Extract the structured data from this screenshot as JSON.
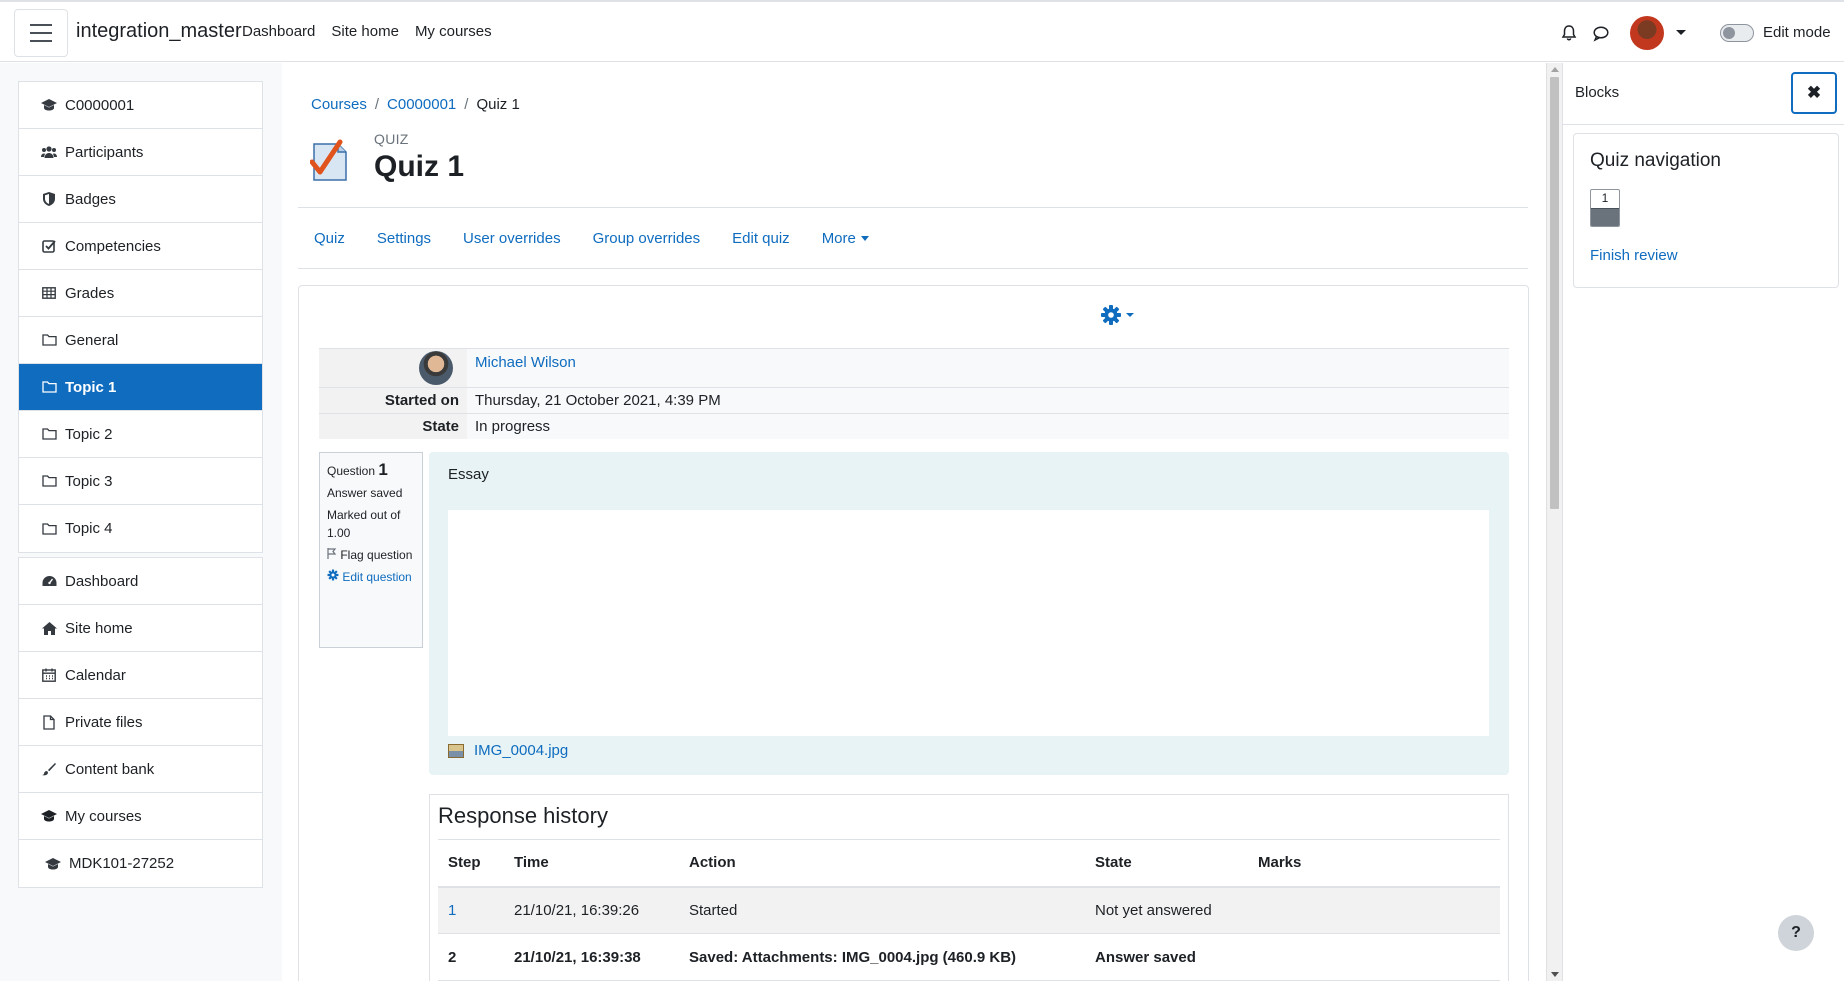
{
  "navbar": {
    "site_name": "integration_master",
    "links": [
      "Dashboard",
      "Site home",
      "My courses"
    ],
    "edit_mode_label": "Edit mode"
  },
  "left_nav": {
    "course_items": [
      {
        "label": "C0000001",
        "icon": "graduation-cap-icon"
      },
      {
        "label": "Participants",
        "icon": "users-icon"
      },
      {
        "label": "Badges",
        "icon": "shield-icon"
      },
      {
        "label": "Competencies",
        "icon": "check-square-icon"
      },
      {
        "label": "Grades",
        "icon": "table-icon"
      },
      {
        "label": "General",
        "icon": "folder-icon"
      },
      {
        "label": "Topic 1",
        "icon": "folder-icon",
        "active": true
      },
      {
        "label": "Topic 2",
        "icon": "folder-icon"
      },
      {
        "label": "Topic 3",
        "icon": "folder-icon"
      },
      {
        "label": "Topic 4",
        "icon": "folder-icon"
      }
    ],
    "site_items": [
      {
        "label": "Dashboard",
        "icon": "dashboard-icon"
      },
      {
        "label": "Site home",
        "icon": "home-icon"
      },
      {
        "label": "Calendar",
        "icon": "calendar-icon"
      },
      {
        "label": "Private files",
        "icon": "file-icon"
      },
      {
        "label": "Content bank",
        "icon": "paintbrush-icon"
      },
      {
        "label": "My courses",
        "icon": "graduation-cap-icon"
      }
    ],
    "sub_items": [
      {
        "label": "MDK101-27252",
        "icon": "graduation-cap-icon"
      }
    ]
  },
  "breadcrumb": [
    "Courses",
    "C0000001",
    "Quiz 1"
  ],
  "header": {
    "type_label": "QUIZ",
    "title": "Quiz 1"
  },
  "secondary_nav": [
    "Quiz",
    "Settings",
    "User overrides",
    "Group overrides",
    "Edit quiz",
    "More"
  ],
  "summary": {
    "user_name": "Michael Wilson",
    "started_on_label": "Started on",
    "started_on_value": "Thursday, 21 October 2021, 4:39 PM",
    "state_label": "State",
    "state_value": "In progress"
  },
  "question": {
    "prefix": "Question",
    "number": "1",
    "status": "Answer saved",
    "marked_out_of": "Marked out of 1.00",
    "flag_label": "Flag question",
    "edit_label": "Edit question",
    "text": "Essay",
    "attachment": "IMG_0004.jpg"
  },
  "response_history": {
    "title": "Response history",
    "columns": [
      "Step",
      "Time",
      "Action",
      "State",
      "Marks"
    ],
    "rows": [
      {
        "step": "1",
        "time": "21/10/21, 16:39:26",
        "action": "Started",
        "state": "Not yet answered",
        "marks": ""
      },
      {
        "step": "2",
        "time": "21/10/21, 16:39:38",
        "action": "Saved: Attachments: IMG_0004.jpg (460.9 KB)",
        "state": "Answer saved",
        "marks": ""
      }
    ]
  },
  "right_drawer": {
    "title": "Blocks",
    "close_label": "✖",
    "quiz_nav_title": "Quiz navigation",
    "quiz_nav_buttons": [
      "1"
    ],
    "finish_review": "Finish review"
  },
  "help_label": "?",
  "colors": {
    "primary": "#0f6cbf",
    "active_bg": "#0f6cbf",
    "question_bg": "#e7f3f5"
  }
}
